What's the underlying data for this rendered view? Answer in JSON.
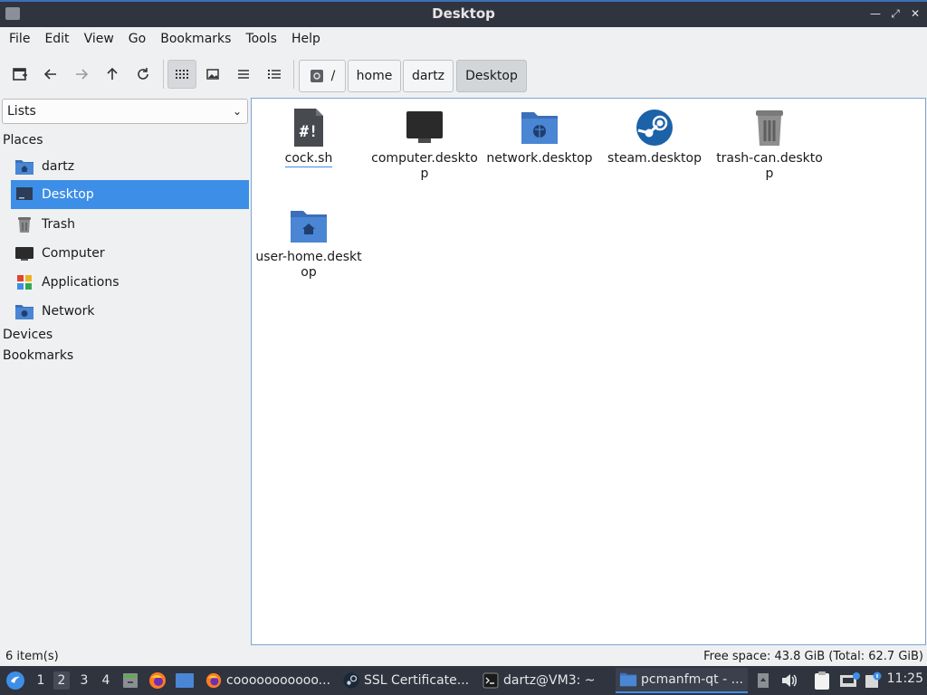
{
  "window": {
    "title": "Desktop"
  },
  "menu": [
    "File",
    "Edit",
    "View",
    "Go",
    "Bookmarks",
    "Tools",
    "Help"
  ],
  "breadcrumb": {
    "root": "/",
    "parts": [
      "home",
      "dartz",
      "Desktop"
    ]
  },
  "side": {
    "selector": "Lists",
    "places_header": "Places",
    "places": [
      "dartz",
      "Desktop",
      "Trash",
      "Computer",
      "Applications",
      "Network"
    ],
    "devices_header": "Devices",
    "bookmarks_header": "Bookmarks"
  },
  "files": [
    {
      "name": "cock.sh",
      "icon": "script-icon"
    },
    {
      "name": "computer.desktop",
      "icon": "monitor-icon"
    },
    {
      "name": "network.desktop",
      "icon": "network-folder-icon"
    },
    {
      "name": "steam.desktop",
      "icon": "steam-icon"
    },
    {
      "name": "trash-can.desktop",
      "icon": "trash-icon"
    },
    {
      "name": "user-home.desktop",
      "icon": "home-folder-icon"
    }
  ],
  "status": {
    "items": "6 item(s)",
    "free": "Free space: 43.8 GiB (Total: 62.7 GiB)"
  },
  "taskbar": {
    "desktops": [
      "1",
      "2",
      "3",
      "4"
    ],
    "tasks": [
      "cooooooooooo...",
      "SSL Certificate...",
      "dartz@VM3: ~",
      "pcmanfm-qt - ..."
    ],
    "clock": "11:25"
  },
  "colors": {
    "accent": "#3d8ee6",
    "titlebar": "#2f343f",
    "folder": "#4a86d4"
  }
}
